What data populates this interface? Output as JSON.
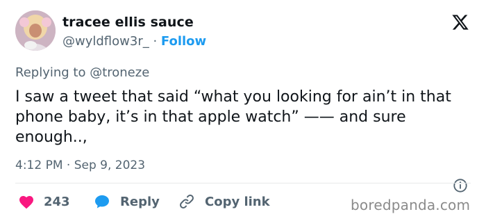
{
  "user": {
    "display_name": "tracee ellis sauce",
    "handle": "@wyldflow3r_",
    "separator": " · ",
    "follow_label": "Follow"
  },
  "reply_context": {
    "prefix": "Replying to ",
    "mention": "@troneze"
  },
  "tweet": {
    "text": "I saw a tweet that said “what you looking for ain’t in that phone baby, it’s in that apple watch” —— and sure enough..,",
    "timestamp": "4:12 PM · Sep 9, 2023"
  },
  "actions": {
    "likes_count": "243",
    "reply_label": "Reply",
    "copy_label": "Copy link"
  },
  "watermark": "boredpanda.com",
  "colors": {
    "accent": "#1d9bf0",
    "like": "#f91880",
    "secondary_text": "#536471",
    "divider": "#e7e9ea"
  },
  "icons": [
    "avatar",
    "x-logo-icon",
    "info-icon",
    "heart-icon",
    "reply-bubble-icon",
    "link-icon"
  ]
}
